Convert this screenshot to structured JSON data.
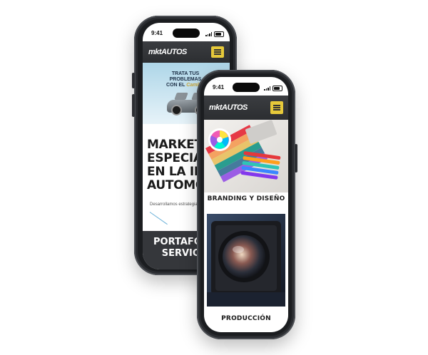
{
  "back_phone": {
    "status_time": "9:41",
    "logo_text": "mktAUTOS",
    "banner_line1": "TRATA TUS PROBLEMAS",
    "banner_line2_prefix": "CON EL",
    "banner_line2_script": "Cambio",
    "hero_title_lines": [
      "MARKETI",
      "ESPECIALIZ",
      "EN LA INDUS",
      "AUTOMOT"
    ],
    "hero_subtitle": "Desarrollamos estrategias a tu",
    "portfolio_lines": [
      "PORTAFOLIO",
      "SERVICIO"
    ]
  },
  "front_phone": {
    "status_time": "9:41",
    "logo_text": "mktAUTOS",
    "card1_caption": "BRANDING Y DISEÑO",
    "card2_caption": "PRODUCCIÓN"
  },
  "colors": {
    "accent_yellow": "#e6c93a",
    "nav_dark": "#2c2e31",
    "phone_frame": "#1b1d20"
  }
}
